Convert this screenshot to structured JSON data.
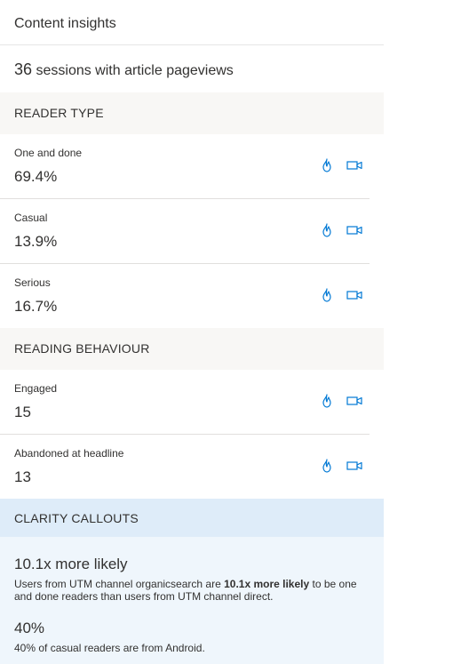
{
  "panel": {
    "title": "Content insights",
    "sessions_count": "36",
    "sessions_text": "sessions with article pageviews"
  },
  "reader_type": {
    "heading": "READER TYPE",
    "metrics": [
      {
        "label": "One and done",
        "value": "69.4%"
      },
      {
        "label": "Casual",
        "value": "13.9%"
      },
      {
        "label": "Serious",
        "value": "16.7%"
      }
    ]
  },
  "reading_behaviour": {
    "heading": "READING BEHAVIOUR",
    "metrics": [
      {
        "label": "Engaged",
        "value": "15"
      },
      {
        "label": "Abandoned at headline",
        "value": "13"
      }
    ]
  },
  "callouts": {
    "heading": "CLARITY CALLOUTS",
    "items": [
      {
        "title": "10.1x more likely",
        "text_before": "Users from UTM channel organicsearch are ",
        "text_bold": "10.1x more likely",
        "text_after": " to be one and done readers than users from UTM channel direct."
      },
      {
        "title": "40%",
        "text": "40% of casual readers are from Android."
      }
    ]
  },
  "icons": {
    "heatmap": "heatmap-flame-icon",
    "recording": "recording-camera-icon"
  },
  "colors": {
    "accent": "#0078d4",
    "section_bg": "#f8f7f5",
    "callout_head_bg": "#deecf9",
    "callout_body_bg": "#eff6fc"
  }
}
